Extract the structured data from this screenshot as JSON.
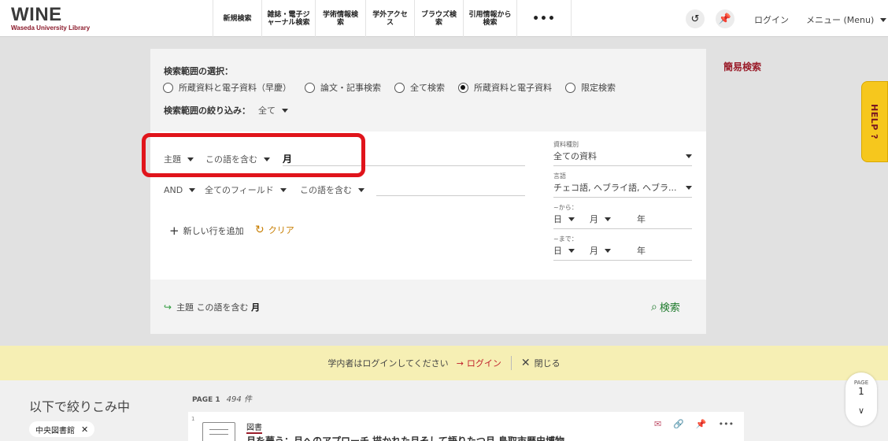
{
  "header": {
    "logo": "WINE",
    "logo_sub": "Waseda University Library",
    "nav": [
      {
        "label": "新規検索",
        "w": 62
      },
      {
        "label": "雑誌・電子ジ\nャーナル検索",
        "w": 68
      },
      {
        "label": "学術情報検索",
        "w": 64
      },
      {
        "label": "学外アクセス",
        "w": 62
      },
      {
        "label": "ブラウズ検索",
        "w": 62
      },
      {
        "label": "引用情報から\n検索",
        "w": 68
      }
    ],
    "more": "•••",
    "login": "ログイン",
    "menu": "メニュー (Menu)"
  },
  "scope": {
    "title": "検索範囲の選択：",
    "options": [
      "所蔵資料と電子資料（早慶）",
      "論文・記事検索",
      "全て検索",
      "所蔵資料と電子資料",
      "限定検索"
    ],
    "selected_index": 3,
    "narrow_label": "検索範囲の絞り込み：",
    "narrow_value": "全て"
  },
  "query": {
    "row1": {
      "field": "主題",
      "op": "この語を含む",
      "value": "月"
    },
    "row2": {
      "bool": "AND",
      "field": "全てのフィールド",
      "op": "この語を含む",
      "value": ""
    },
    "add_row": "新しい行を追加",
    "clear": "クリア"
  },
  "filters": {
    "material_label": "資料種別",
    "material_value": "全ての資料",
    "language_label": "言語",
    "language_value": "チェコ語, ヘブライ語, ヘブラ...",
    "from_label": "~から：",
    "to_label": "~まで：",
    "day": "日",
    "month": "月",
    "year": "年"
  },
  "summary": {
    "field": "主題",
    "op": "この語を含む",
    "value": "月",
    "search": "検索"
  },
  "simple_search": "簡易検索",
  "help": "HELP ?",
  "banner": {
    "text": "学内者はログインしてください",
    "login": "ログイン",
    "close": "閉じる"
  },
  "results": {
    "refine_title": "以下で絞りこみ中",
    "chip": "中央図書館",
    "page_label": "PAGE 1",
    "count": "494 件",
    "item": {
      "num": "1",
      "type": "図書",
      "title": "月を夢う：月へのアプローチ 描かれた月そして語りたつ月 島取市歴史博物"
    }
  },
  "pager": {
    "label": "PAGE",
    "num": "1"
  }
}
